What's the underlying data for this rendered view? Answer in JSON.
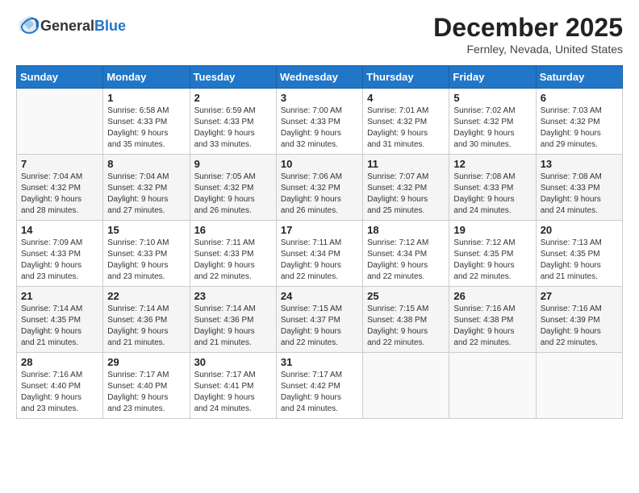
{
  "header": {
    "logo_general": "General",
    "logo_blue": "Blue",
    "month_title": "December 2025",
    "location": "Fernley, Nevada, United States"
  },
  "days_of_week": [
    "Sunday",
    "Monday",
    "Tuesday",
    "Wednesday",
    "Thursday",
    "Friday",
    "Saturday"
  ],
  "weeks": [
    [
      {
        "day": "",
        "info": ""
      },
      {
        "day": "1",
        "info": "Sunrise: 6:58 AM\nSunset: 4:33 PM\nDaylight: 9 hours\nand 35 minutes."
      },
      {
        "day": "2",
        "info": "Sunrise: 6:59 AM\nSunset: 4:33 PM\nDaylight: 9 hours\nand 33 minutes."
      },
      {
        "day": "3",
        "info": "Sunrise: 7:00 AM\nSunset: 4:33 PM\nDaylight: 9 hours\nand 32 minutes."
      },
      {
        "day": "4",
        "info": "Sunrise: 7:01 AM\nSunset: 4:32 PM\nDaylight: 9 hours\nand 31 minutes."
      },
      {
        "day": "5",
        "info": "Sunrise: 7:02 AM\nSunset: 4:32 PM\nDaylight: 9 hours\nand 30 minutes."
      },
      {
        "day": "6",
        "info": "Sunrise: 7:03 AM\nSunset: 4:32 PM\nDaylight: 9 hours\nand 29 minutes."
      }
    ],
    [
      {
        "day": "7",
        "info": "Sunrise: 7:04 AM\nSunset: 4:32 PM\nDaylight: 9 hours\nand 28 minutes."
      },
      {
        "day": "8",
        "info": "Sunrise: 7:04 AM\nSunset: 4:32 PM\nDaylight: 9 hours\nand 27 minutes."
      },
      {
        "day": "9",
        "info": "Sunrise: 7:05 AM\nSunset: 4:32 PM\nDaylight: 9 hours\nand 26 minutes."
      },
      {
        "day": "10",
        "info": "Sunrise: 7:06 AM\nSunset: 4:32 PM\nDaylight: 9 hours\nand 26 minutes."
      },
      {
        "day": "11",
        "info": "Sunrise: 7:07 AM\nSunset: 4:32 PM\nDaylight: 9 hours\nand 25 minutes."
      },
      {
        "day": "12",
        "info": "Sunrise: 7:08 AM\nSunset: 4:33 PM\nDaylight: 9 hours\nand 24 minutes."
      },
      {
        "day": "13",
        "info": "Sunrise: 7:08 AM\nSunset: 4:33 PM\nDaylight: 9 hours\nand 24 minutes."
      }
    ],
    [
      {
        "day": "14",
        "info": "Sunrise: 7:09 AM\nSunset: 4:33 PM\nDaylight: 9 hours\nand 23 minutes."
      },
      {
        "day": "15",
        "info": "Sunrise: 7:10 AM\nSunset: 4:33 PM\nDaylight: 9 hours\nand 23 minutes."
      },
      {
        "day": "16",
        "info": "Sunrise: 7:11 AM\nSunset: 4:33 PM\nDaylight: 9 hours\nand 22 minutes."
      },
      {
        "day": "17",
        "info": "Sunrise: 7:11 AM\nSunset: 4:34 PM\nDaylight: 9 hours\nand 22 minutes."
      },
      {
        "day": "18",
        "info": "Sunrise: 7:12 AM\nSunset: 4:34 PM\nDaylight: 9 hours\nand 22 minutes."
      },
      {
        "day": "19",
        "info": "Sunrise: 7:12 AM\nSunset: 4:35 PM\nDaylight: 9 hours\nand 22 minutes."
      },
      {
        "day": "20",
        "info": "Sunrise: 7:13 AM\nSunset: 4:35 PM\nDaylight: 9 hours\nand 21 minutes."
      }
    ],
    [
      {
        "day": "21",
        "info": "Sunrise: 7:14 AM\nSunset: 4:35 PM\nDaylight: 9 hours\nand 21 minutes."
      },
      {
        "day": "22",
        "info": "Sunrise: 7:14 AM\nSunset: 4:36 PM\nDaylight: 9 hours\nand 21 minutes."
      },
      {
        "day": "23",
        "info": "Sunrise: 7:14 AM\nSunset: 4:36 PM\nDaylight: 9 hours\nand 21 minutes."
      },
      {
        "day": "24",
        "info": "Sunrise: 7:15 AM\nSunset: 4:37 PM\nDaylight: 9 hours\nand 22 minutes."
      },
      {
        "day": "25",
        "info": "Sunrise: 7:15 AM\nSunset: 4:38 PM\nDaylight: 9 hours\nand 22 minutes."
      },
      {
        "day": "26",
        "info": "Sunrise: 7:16 AM\nSunset: 4:38 PM\nDaylight: 9 hours\nand 22 minutes."
      },
      {
        "day": "27",
        "info": "Sunrise: 7:16 AM\nSunset: 4:39 PM\nDaylight: 9 hours\nand 22 minutes."
      }
    ],
    [
      {
        "day": "28",
        "info": "Sunrise: 7:16 AM\nSunset: 4:40 PM\nDaylight: 9 hours\nand 23 minutes."
      },
      {
        "day": "29",
        "info": "Sunrise: 7:17 AM\nSunset: 4:40 PM\nDaylight: 9 hours\nand 23 minutes."
      },
      {
        "day": "30",
        "info": "Sunrise: 7:17 AM\nSunset: 4:41 PM\nDaylight: 9 hours\nand 24 minutes."
      },
      {
        "day": "31",
        "info": "Sunrise: 7:17 AM\nSunset: 4:42 PM\nDaylight: 9 hours\nand 24 minutes."
      },
      {
        "day": "",
        "info": ""
      },
      {
        "day": "",
        "info": ""
      },
      {
        "day": "",
        "info": ""
      }
    ]
  ]
}
